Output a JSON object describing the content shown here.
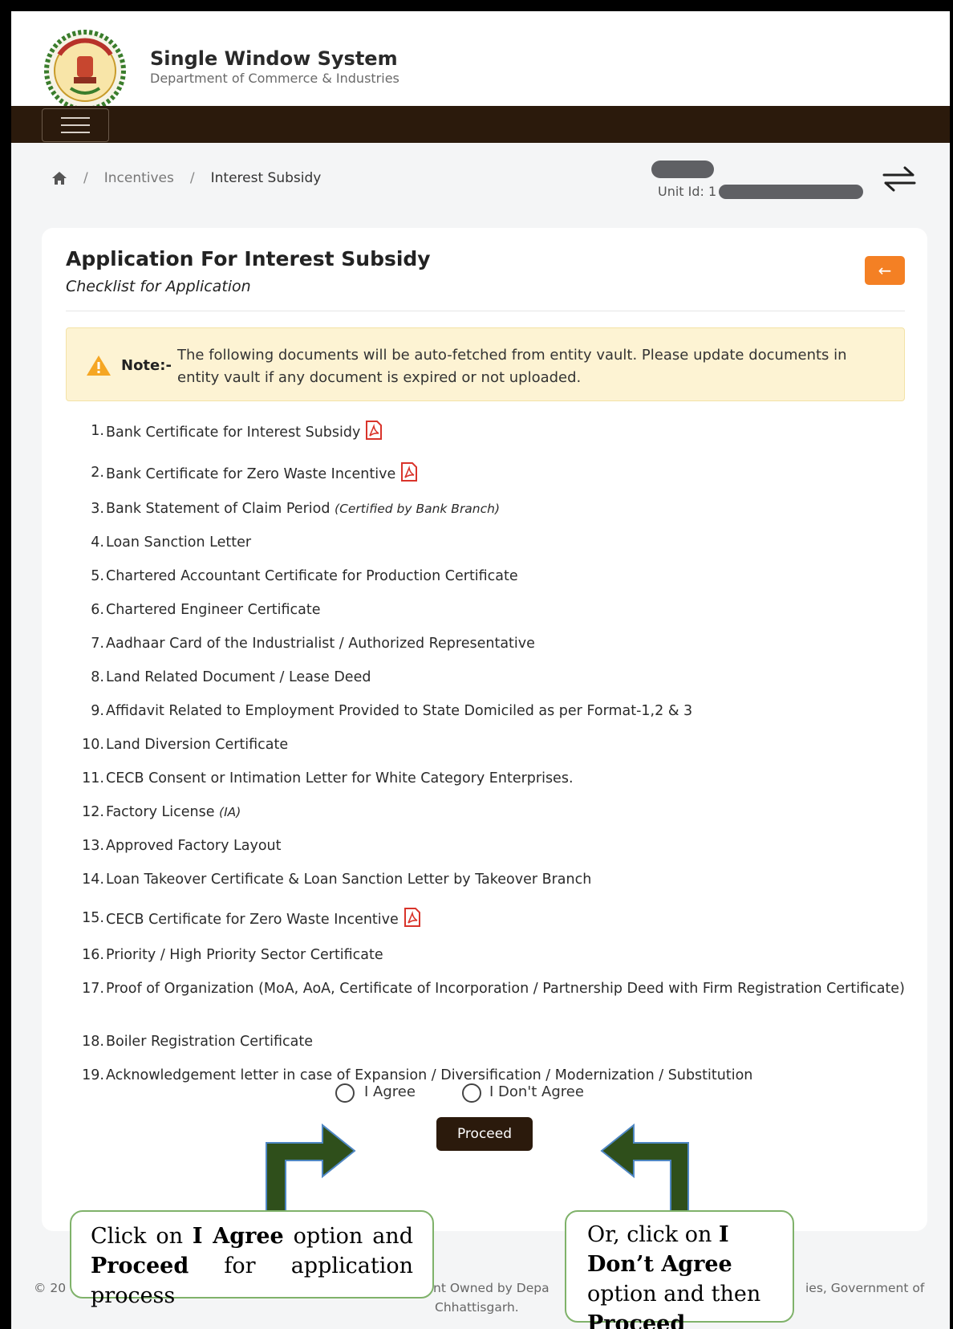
{
  "header": {
    "title": "Single Window System",
    "subtitle": "Department of Commerce & Industries",
    "emblem_icon": "state-emblem",
    "menu_icon": "hamburger-icon"
  },
  "breadcrumb": {
    "home_icon": "home-icon",
    "sep1": "/",
    "item1": "Incentives",
    "sep2": "/",
    "item2": "Interest Subsidy"
  },
  "unit": {
    "label": "Unit Id: 1"
  },
  "card": {
    "title": "Application For Interest Subsidy",
    "subtitle": "Checklist for Application",
    "back_label": "←"
  },
  "note": {
    "label": "Note:-",
    "text": "The following documents will be auto-fetched from entity vault. Please update documents in entity vault if any document is expired or not uploaded."
  },
  "documents": [
    {
      "num": "1.",
      "text": "Bank Certificate for Interest Subsidy",
      "qualifier": "",
      "pdf": true
    },
    {
      "num": "2.",
      "text": "Bank Certificate for Zero Waste Incentive",
      "qualifier": "",
      "pdf": true
    },
    {
      "num": "3.",
      "text": "Bank Statement of Claim Period",
      "qualifier": "(Certified by Bank Branch)",
      "pdf": false
    },
    {
      "num": "4.",
      "text": "Loan Sanction Letter",
      "qualifier": "",
      "pdf": false
    },
    {
      "num": "5.",
      "text": "Chartered Accountant Certificate for Production Certificate",
      "qualifier": "",
      "pdf": false
    },
    {
      "num": "6.",
      "text": "Chartered Engineer Certificate",
      "qualifier": "",
      "pdf": false
    },
    {
      "num": "7.",
      "text": "Aadhaar Card of the Industrialist / Authorized Representative",
      "qualifier": "",
      "pdf": false
    },
    {
      "num": "8.",
      "text": "Land Related Document / Lease Deed",
      "qualifier": "",
      "pdf": false
    },
    {
      "num": "9.",
      "text": "Affidavit Related to Employment Provided to State Domiciled as per Format-1,2 & 3",
      "qualifier": "",
      "pdf": false
    },
    {
      "num": "10.",
      "text": "Land Diversion Certificate",
      "qualifier": "",
      "pdf": false
    },
    {
      "num": "11.",
      "text": "CECB Consent or Intimation Letter for White Category Enterprises.",
      "qualifier": "",
      "pdf": false
    },
    {
      "num": "12.",
      "text": "Factory License",
      "qualifier": "(IA)",
      "pdf": false
    },
    {
      "num": "13.",
      "text": "Approved Factory Layout",
      "qualifier": "",
      "pdf": false
    },
    {
      "num": "14.",
      "text": "Loan Takeover Certificate & Loan Sanction Letter by Takeover Branch",
      "qualifier": "",
      "pdf": false
    },
    {
      "num": "15.",
      "text": "CECB Certificate for Zero Waste Incentive",
      "qualifier": "",
      "pdf": true
    },
    {
      "num": "16.",
      "text": "Priority / High Priority Sector Certificate",
      "qualifier": "",
      "pdf": false
    },
    {
      "num": "17.",
      "text": "Proof of Organization (MoA, AoA, Certificate of Incorporation / Partnership Deed with Firm Registration Certificate)",
      "qualifier": "",
      "pdf": false
    },
    {
      "num": "18.",
      "text": "Boiler Registration Certificate",
      "qualifier": "",
      "pdf": false
    },
    {
      "num": "19.",
      "text": "Acknowledgement letter in case of Expansion / Diversification / Modernization / Substitution",
      "qualifier": "",
      "pdf": false
    }
  ],
  "agreement": {
    "agree_label": "I Agree",
    "disagree_label": "I Don't Agree",
    "proceed_label": "Proceed"
  },
  "footer": {
    "part1": "© 20",
    "part2": "nt Owned by Depa",
    "part3": "ies, Government of",
    "part4": "Chhattisgarh."
  },
  "callouts": {
    "left": {
      "t1": "Click on ",
      "b1": "I Agree",
      "t2": " option and ",
      "b2": "Proceed",
      "t3": " for application process"
    },
    "right": {
      "t1": "Or, click on ",
      "b1": "I Don’t Agree",
      "t2": " option and then ",
      "b2": "Proceed"
    }
  },
  "colors": {
    "navbar": "#2b1a0c",
    "accent_orange": "#f48024",
    "note_bg": "#fdf3d3",
    "pdf_red": "#d9342b",
    "arrow_green": "#2f4f1b",
    "callout_border": "#7fb26a"
  }
}
